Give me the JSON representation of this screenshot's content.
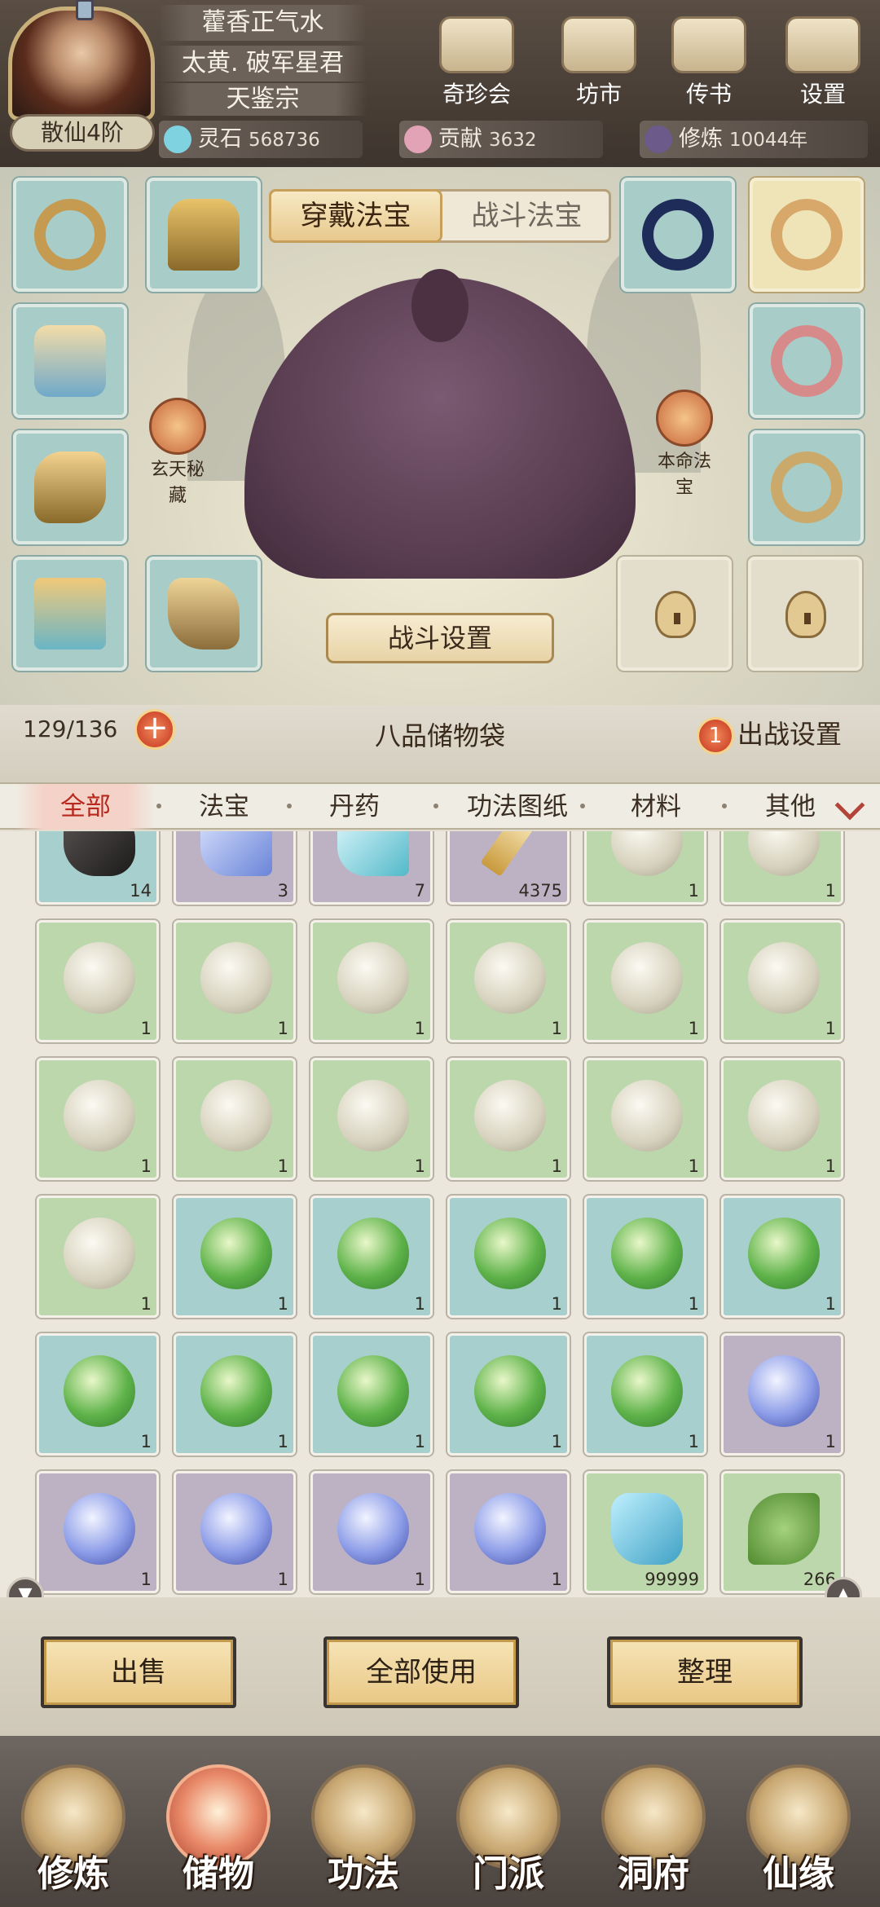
{
  "player": {
    "name_line1": "藿香正气水",
    "name_line2": "太黄. 破军星君",
    "sect": "天鉴宗",
    "realm": "散仙4阶"
  },
  "top_buttons": [
    {
      "label": "奇珍会"
    },
    {
      "label": "坊市"
    },
    {
      "label": "传书"
    },
    {
      "label": "设置"
    }
  ],
  "resources": [
    {
      "label": "灵石",
      "value": "568736"
    },
    {
      "label": "贡献",
      "value": "3632"
    },
    {
      "label": "修炼",
      "value": "10044年"
    }
  ],
  "equip_tabs": {
    "active": "穿戴法宝",
    "inactive": "战斗法宝"
  },
  "side_labels": {
    "left": "玄天秘藏",
    "right": "本命法宝"
  },
  "battle_settings": "战斗设置",
  "bag": {
    "capacity": "129/136",
    "title": "八品储物袋",
    "deploy_badge": "1",
    "deploy_label": "出战设置"
  },
  "filters": [
    "全部",
    "法宝",
    "丹药",
    "功法图纸",
    "材料",
    "其他"
  ],
  "items": [
    {
      "icon": "dark-stone",
      "qty": "14",
      "bg": "b"
    },
    {
      "icon": "blue-crystal",
      "qty": "3",
      "bg": "p"
    },
    {
      "icon": "cyan-crystal",
      "qty": "7",
      "bg": "p"
    },
    {
      "icon": "gold-sword-shard",
      "qty": "4375",
      "bg": "p"
    },
    {
      "icon": "white-orb",
      "qty": "1",
      "bg": "g"
    },
    {
      "icon": "white-orb",
      "qty": "1",
      "bg": "g"
    },
    {
      "icon": "white-orb",
      "qty": "1",
      "bg": "g"
    },
    {
      "icon": "white-orb",
      "qty": "1",
      "bg": "g"
    },
    {
      "icon": "white-orb",
      "qty": "1",
      "bg": "g"
    },
    {
      "icon": "white-orb",
      "qty": "1",
      "bg": "g"
    },
    {
      "icon": "white-orb",
      "qty": "1",
      "bg": "g"
    },
    {
      "icon": "white-orb",
      "qty": "1",
      "bg": "g"
    },
    {
      "icon": "white-orb",
      "qty": "1",
      "bg": "g"
    },
    {
      "icon": "white-orb",
      "qty": "1",
      "bg": "g"
    },
    {
      "icon": "white-orb",
      "qty": "1",
      "bg": "g"
    },
    {
      "icon": "white-orb",
      "qty": "1",
      "bg": "g"
    },
    {
      "icon": "white-orb",
      "qty": "1",
      "bg": "g"
    },
    {
      "icon": "white-orb",
      "qty": "1",
      "bg": "g"
    },
    {
      "icon": "white-orb",
      "qty": "1",
      "bg": "g"
    },
    {
      "icon": "green-orb",
      "qty": "1",
      "bg": "b"
    },
    {
      "icon": "green-orb",
      "qty": "1",
      "bg": "b"
    },
    {
      "icon": "green-orb",
      "qty": "1",
      "bg": "b"
    },
    {
      "icon": "green-orb",
      "qty": "1",
      "bg": "b"
    },
    {
      "icon": "green-orb",
      "qty": "1",
      "bg": "b"
    },
    {
      "icon": "green-orb",
      "qty": "1",
      "bg": "b"
    },
    {
      "icon": "green-orb",
      "qty": "1",
      "bg": "b"
    },
    {
      "icon": "green-orb",
      "qty": "1",
      "bg": "b"
    },
    {
      "icon": "green-orb",
      "qty": "1",
      "bg": "b"
    },
    {
      "icon": "green-orb",
      "qty": "1",
      "bg": "b"
    },
    {
      "icon": "blue-orb",
      "qty": "1",
      "bg": "p"
    },
    {
      "icon": "blue-orb",
      "qty": "1",
      "bg": "p"
    },
    {
      "icon": "blue-orb",
      "qty": "1",
      "bg": "p"
    },
    {
      "icon": "blue-orb",
      "qty": "1",
      "bg": "p"
    },
    {
      "icon": "blue-orb",
      "qty": "1",
      "bg": "p"
    },
    {
      "icon": "ice-crystal",
      "qty": "99999",
      "bg": "g"
    },
    {
      "icon": "spirit-herb",
      "qty": "266",
      "bg": "g"
    }
  ],
  "actions": {
    "sell": "出售",
    "use_all": "全部使用",
    "sort": "整理"
  },
  "nav": [
    {
      "label": "修炼"
    },
    {
      "label": "储物",
      "active": true
    },
    {
      "label": "功法"
    },
    {
      "label": "门派"
    },
    {
      "label": "洞府"
    },
    {
      "label": "仙缘"
    }
  ]
}
